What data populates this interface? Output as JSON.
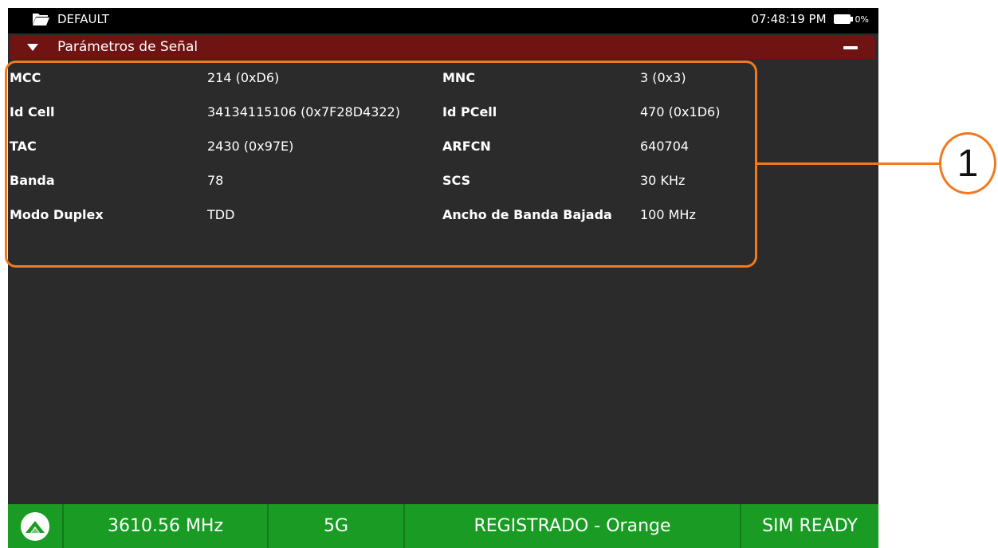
{
  "statusbar": {
    "profile": "DEFAULT",
    "time": "07:48:19 PM",
    "battery": "0%"
  },
  "section": {
    "title": "Parámetros de Señal"
  },
  "params": [
    {
      "l1": "MCC",
      "v1": "214 (0xD6)",
      "l2": "MNC",
      "v2": "3 (0x3)"
    },
    {
      "l1": "Id Cell",
      "v1": "34134115106 (0x7F28D4322)",
      "l2": "Id PCell",
      "v2": "470 (0x1D6)"
    },
    {
      "l1": "TAC",
      "v1": "2430 (0x97E)",
      "l2": "ARFCN",
      "v2": "640704"
    },
    {
      "l1": "Banda",
      "v1": "78",
      "l2": "SCS",
      "v2": "30 KHz"
    },
    {
      "l1": "Modo Duplex",
      "v1": "TDD",
      "l2": "Ancho de Banda Bajada",
      "v2": "100 MHz"
    }
  ],
  "callout": {
    "number": "1",
    "color": "#f07a1f"
  },
  "bottombar": {
    "frequency": "3610.56 MHz",
    "technology": "5G",
    "registration": "REGISTRADO - Orange",
    "sim": "SIM READY",
    "color": "#1a9c24"
  },
  "colors": {
    "header": "#701313",
    "panel": "#2b2b2b"
  },
  "icons": {
    "profile": "folder-icon",
    "battery": "battery-icon",
    "expand": "triangle-down-icon",
    "collapse": "minus-icon",
    "logo": "mountain-logo-icon"
  }
}
